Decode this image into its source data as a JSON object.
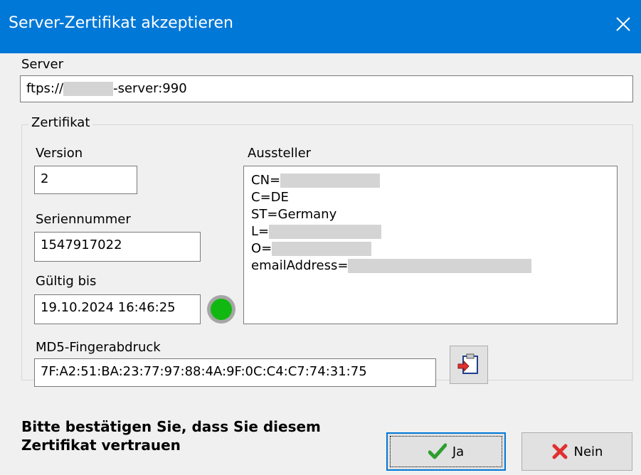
{
  "window": {
    "title": "Server-Zertifikat akzeptieren"
  },
  "server": {
    "label": "Server",
    "value_prefix": "ftps://",
    "value_suffix": "-server:990"
  },
  "certificate": {
    "group_label": "Zertifikat",
    "version_label": "Version",
    "version": "2",
    "serial_label": "Seriennummer",
    "serial": "1547917022",
    "valid_label": "Gültig bis",
    "valid_until": "19.10.2024 16:46:25",
    "status_color": "#11b811",
    "issuer_label": "Aussteller",
    "issuer_lines": [
      "CN=",
      "C=DE",
      "ST=Germany",
      "L=",
      "O=",
      "emailAddress="
    ],
    "fingerprint_label": "MD5-Fingerabdruck",
    "fingerprint": "7F:A2:51:BA:23:77:97:88:4A:9F:0C:C4:C7:74:31:75"
  },
  "prompt": "Bitte bestätigen Sie, dass Sie diesem Zertifikat vertrauen",
  "buttons": {
    "yes": "Ja",
    "no": "Nein"
  },
  "colors": {
    "titlebar": "#0078d7",
    "yes_check": "#2e9e2e",
    "no_x": "#e03030",
    "default_border": "#0078d7"
  }
}
